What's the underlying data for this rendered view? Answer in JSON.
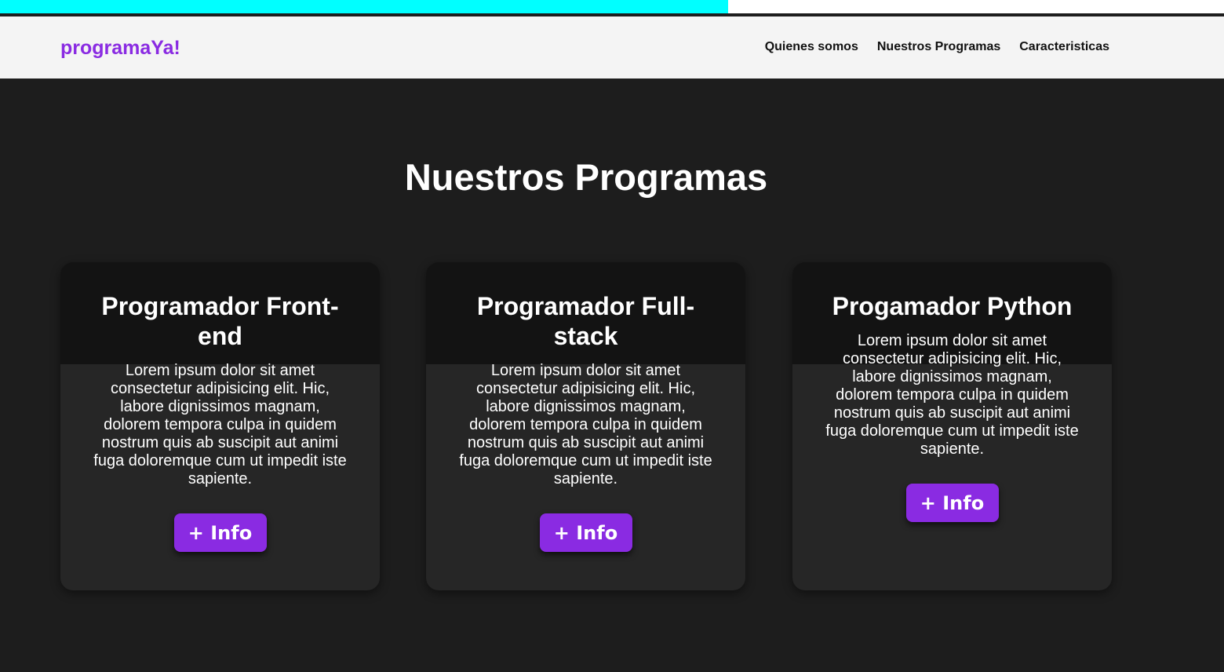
{
  "progress": {
    "fraction": 0.595,
    "colors": {
      "fill": "#00ffff",
      "track": "#ffffff"
    }
  },
  "header": {
    "logo": "programaYa!",
    "nav": [
      "Quienes somos",
      "Nuestros Programas",
      "Caracteristicas"
    ]
  },
  "section": {
    "title": "Nuestros Programas",
    "cards": [
      {
        "title": "Programador Front-end",
        "text": "Lorem ipsum dolor sit amet consectetur adipisicing elit. Hic, labore dignissimos magnam, dolorem tempora culpa in quidem nostrum quis ab suscipit aut animi fuga doloremque cum ut impedit iste sapiente.",
        "button": "+ Info"
      },
      {
        "title": "Programador Full-stack",
        "text": "Lorem ipsum dolor sit amet consectetur adipisicing elit. Hic, labore dignissimos magnam, dolorem tempora culpa in quidem nostrum quis ab suscipit aut animi fuga doloremque cum ut impedit iste sapiente.",
        "button": "+ Info"
      },
      {
        "title": "Progamador Python",
        "text": "Lorem ipsum dolor sit amet consectetur adipisicing elit. Hic, labore dignissimos magnam, dolorem tempora culpa in quidem nostrum quis ab suscipit aut animi fuga doloremque cum ut impedit iste sapiente.",
        "button": "+ Info"
      }
    ]
  },
  "colors": {
    "accent": "#8a2be2",
    "background": "#1d1d1d",
    "card": "#262626",
    "card_header": "#131313"
  }
}
